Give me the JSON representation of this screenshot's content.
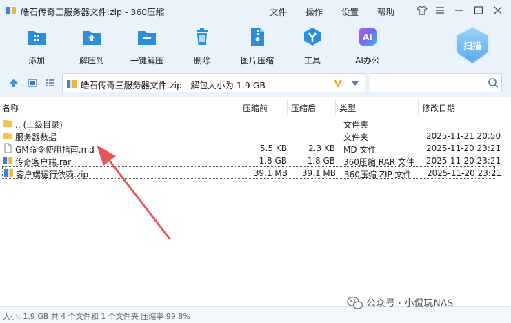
{
  "window": {
    "title": "皓石传奇三服务器文件.zip - 360压缩",
    "menu": [
      "文件",
      "操作",
      "设置",
      "帮助"
    ]
  },
  "toolbar": {
    "tools": [
      {
        "label": "添加",
        "icon": "add-icon"
      },
      {
        "label": "解压到",
        "icon": "extract-to-icon"
      },
      {
        "label": "一键解压",
        "icon": "one-click-extract-icon"
      },
      {
        "label": "删除",
        "icon": "trash-icon"
      },
      {
        "label": "图片压缩",
        "icon": "image-compress-icon"
      },
      {
        "label": "工具",
        "icon": "tools-icon"
      },
      {
        "label": "AI办公",
        "icon": "ai-office-icon"
      }
    ],
    "scan_label": "扫描"
  },
  "address": {
    "text": "皓石传奇三服务器文件.zip - 解包大小为 1.9 GB"
  },
  "columns": {
    "name": "名称",
    "before": "压缩前",
    "after": "压缩后",
    "type": "类型",
    "modified": "修改日期"
  },
  "files": [
    {
      "name": ".. (上级目录)",
      "before": "",
      "after": "",
      "type": "文件夹",
      "modified": "",
      "icon": "folder-icon"
    },
    {
      "name": "服务器数据",
      "before": "",
      "after": "",
      "type": "文件夹",
      "modified": "2025-11-21 20:50",
      "icon": "folder-icon"
    },
    {
      "name": "GM命令使用指南.md",
      "before": "5.5 KB",
      "after": "2.3 KB",
      "type": "MD 文件",
      "modified": "2025-11-20 23:21",
      "icon": "document-icon"
    },
    {
      "name": "传奇客户端.rar",
      "before": "1.8 GB",
      "after": "1.8 GB",
      "type": "360压缩 RAR 文件",
      "modified": "2025-11-20 23:21",
      "icon": "archive-icon"
    },
    {
      "name": "客户端运行依赖.zip",
      "before": "39.1 MB",
      "after": "39.1 MB",
      "type": "360压缩 ZIP 文件",
      "modified": "2025-11-20 23:21",
      "icon": "archive-icon"
    }
  ],
  "status": {
    "text": "大小: 1.9 GB 共 4 个文件和 1 个文件夹 压缩率 99.8%"
  },
  "watermark": {
    "text": "公众号 · 小侃玩NAS"
  },
  "colors": {
    "accent": "#2a8fd8",
    "toolbar_bg": "#eaf3fc",
    "arrow": "#e8545a",
    "folder": "#f5c44e"
  }
}
